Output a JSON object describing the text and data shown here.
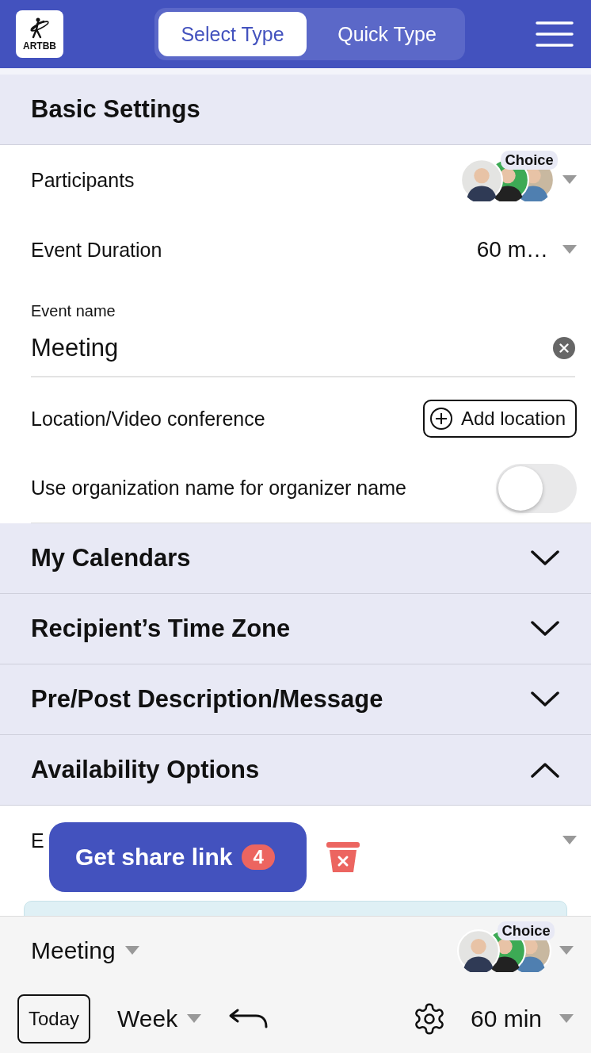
{
  "header": {
    "logo": "ARTBB",
    "tabs": [
      {
        "label": "Select Type",
        "selected": true
      },
      {
        "label": "Quick Type",
        "selected": false
      }
    ]
  },
  "basic_settings": {
    "title": "Basic Settings",
    "participants": {
      "label": "Participants",
      "badge": "Choice"
    },
    "duration": {
      "label": "Event Duration",
      "value": "60 m…"
    },
    "event_name": {
      "label": "Event name",
      "value": "Meeting"
    },
    "location": {
      "label": "Location/Video conference",
      "button": "Add location"
    },
    "org_name": {
      "label": "Use organization name for organizer name",
      "on": false
    }
  },
  "sections": [
    {
      "title": "My Calendars",
      "expanded": false
    },
    {
      "title": "Recipient’s Time Zone",
      "expanded": false
    },
    {
      "title": "Pre/Post Description/Message",
      "expanded": false
    },
    {
      "title": "Availability Options",
      "expanded": true
    }
  ],
  "availability": {
    "row_label": "E"
  },
  "share": {
    "label": "Get share link",
    "count": "4"
  },
  "bottom_bar": {
    "event": "Meeting",
    "badge": "Choice",
    "today": "Today",
    "view": "Week",
    "duration": "60 min"
  }
}
